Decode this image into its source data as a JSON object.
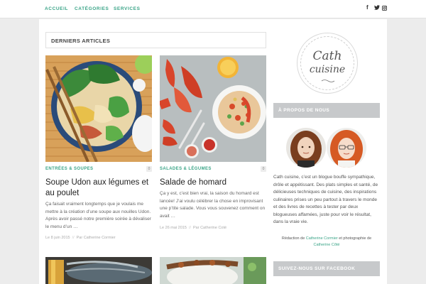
{
  "nav": {
    "items": [
      "ACCUEIL",
      "CATÉGORIES",
      "SERVICES"
    ],
    "social": [
      {
        "icon": "facebook-icon",
        "glyph": "f"
      },
      {
        "icon": "twitter-icon",
        "glyph": "t"
      },
      {
        "icon": "instagram-icon",
        "glyph": "◙"
      }
    ]
  },
  "main": {
    "section_title": "DERNIERS ARTICLES",
    "posts": [
      {
        "category": "ENTRÉES & SOUPES",
        "comments": "0",
        "title": "Soupe Udon aux légumes et au poulet",
        "excerpt": "Ça faisait vraiment longtemps que je voulais me mettre à la création d’une soupe aux nouilles Udon. Après avoir passé notre première soirée à dévaliser le menu d’un …",
        "date": "Le 8 juin 2015",
        "author": "Par Catherine Cormier"
      },
      {
        "category": "SALADES & LÉGUMES",
        "comments": "0",
        "title": "Salade de homard",
        "excerpt": "Ça y est, c’est bien vrai, la saison du homard est lancée! J’ai voulu célébrer la chose en improvisant une p’tite salade. Vous vous souvenez comment on avait …",
        "date": "Le 26 mai 2015",
        "author": "Par Catherine Coté"
      }
    ]
  },
  "sidebar": {
    "logo_line1": "Cath",
    "logo_line2": "cuisine",
    "about_title": "À PROPOS DE NOUS",
    "about_text": "Cath cuisine, c’est un blogue bouffe sympathique, drôle et appétissant. Des plats simples et santé, de délicieuses techniques de cuisine, des inspirations culinaires prises un peu partout à travers le monde et des livres de recettes à tester par deux blogueuses affamées, juste pour voir le résultat, dans la vraie vie.",
    "credit_prefix": "Rédaction de",
    "credit_name1": "Catherine Cormier",
    "credit_mid": "et photographie de",
    "credit_name2": "Catherine Côté",
    "facebook_title": "SUIVEZ-NOUS SUR FACEBOOK"
  },
  "colors": {
    "accent": "#3aa487",
    "widget_header": "#c7c9cb",
    "page_bg": "#ececec"
  }
}
